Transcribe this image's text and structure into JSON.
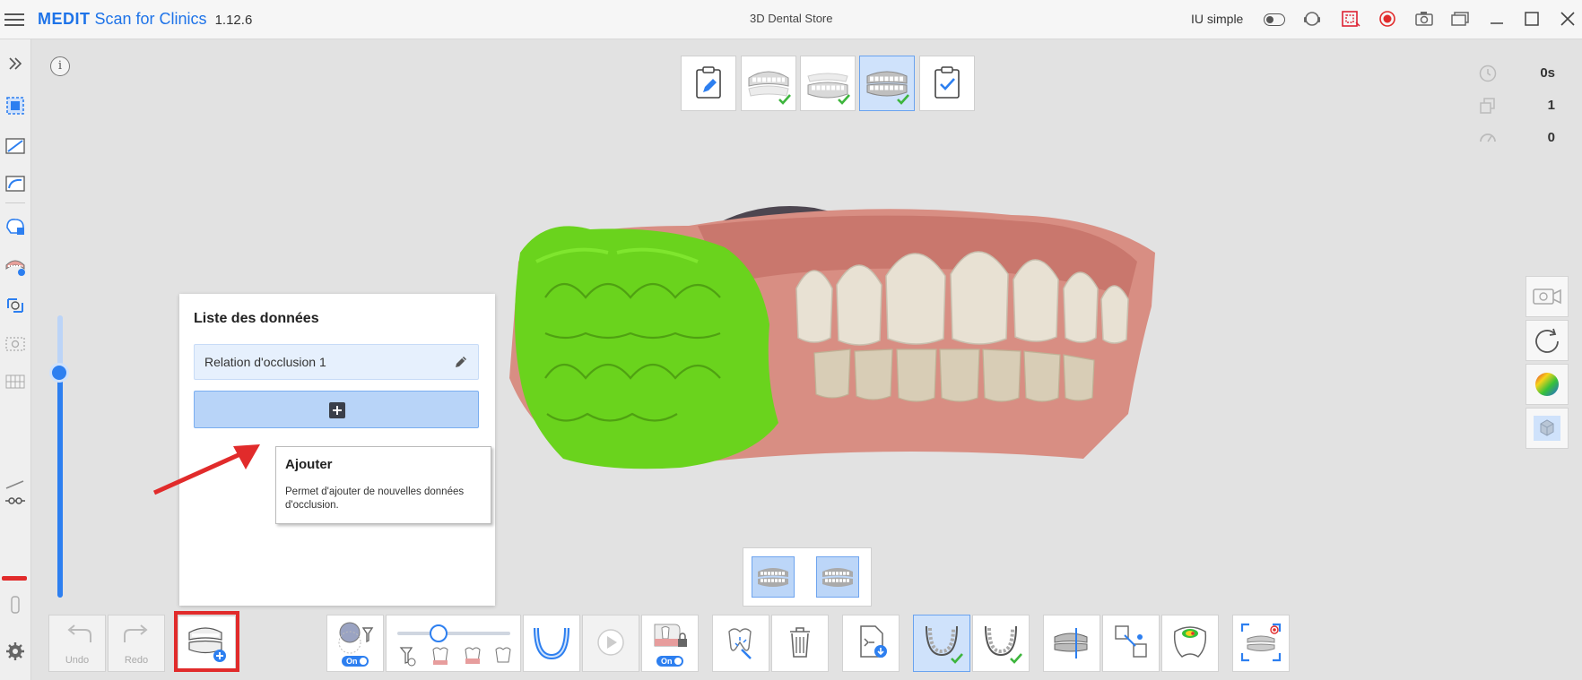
{
  "titlebar": {
    "brand_bold": "MEDIT",
    "brand_rest": "Scan for Clinics",
    "version": "1.12.6",
    "center_title": "3D Dental Store",
    "simple_ui_label": "IU simple"
  },
  "stats": {
    "time": "0s",
    "count": "1",
    "rate": "0"
  },
  "data_list": {
    "title": "Liste des données",
    "item_label": "Relation d'occlusion 1"
  },
  "tooltip": {
    "title": "Ajouter",
    "body": "Permet d'ajouter de nouvelles données d'occlusion."
  },
  "toolbar": {
    "undo_label": "Undo",
    "redo_label": "Redo",
    "on_label": "On"
  },
  "colors": {
    "accent": "#2d7ff0",
    "brand": "#1e73e8",
    "highlight_red": "#e12b2b",
    "scan_green": "#6ad31d",
    "check_green": "#3db53d"
  }
}
